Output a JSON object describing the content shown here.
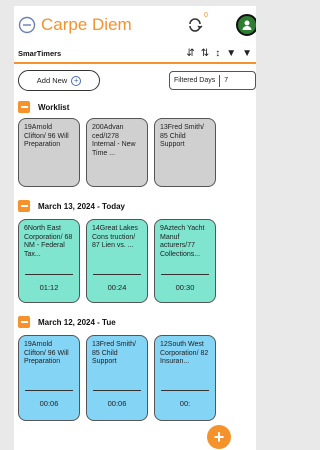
{
  "header": {
    "title": "Carpe Diem",
    "sync_badge": "0"
  },
  "subbar": {
    "title": "SmarTimers",
    "icons": [
      "sort-desc-icon",
      "sort-asc-icon",
      "sort-toggle-icon",
      "filter-icon",
      "clear-filter-icon"
    ]
  },
  "actions": {
    "add_label": "Add New",
    "filter_label": "Filtered Days",
    "filter_value": "7"
  },
  "sections": [
    {
      "title": "Worklist",
      "cards": [
        {
          "text": "19Arnold Clifton/ 96 Will Preparation",
          "time": ""
        },
        {
          "text": "200Advan ced/I278 Internal - New Time ...",
          "time": ""
        },
        {
          "text": "13Fred Smith/ 85 Child Support",
          "time": ""
        }
      ]
    },
    {
      "title": "March 13, 2024 - Today",
      "cards": [
        {
          "text": "6North East Corporation/ 68 NM - Federal Tax...",
          "time": "01:12"
        },
        {
          "text": "14Great Lakes Cons truction/ 87 Lien vs. ...",
          "time": "00:24"
        },
        {
          "text": "9Aztech Yacht Manuf acturers/77 Collections...",
          "time": "00:30"
        }
      ]
    },
    {
      "title": "March 12, 2024 - Tue",
      "cards": [
        {
          "text": "19Arnold Clifton/ 96 Will Preparation",
          "time": "00:06"
        },
        {
          "text": "13Fred Smith/ 85 Child Support",
          "time": "00:06"
        },
        {
          "text": "12South West Corporation/ 82 Insuran...",
          "time": "00:"
        }
      ]
    }
  ],
  "colors": {
    "accent": "#f5922b",
    "worklist_card": "#d0d0d0",
    "today_card": "#7fe5cf",
    "past_card": "#84d4f6"
  }
}
